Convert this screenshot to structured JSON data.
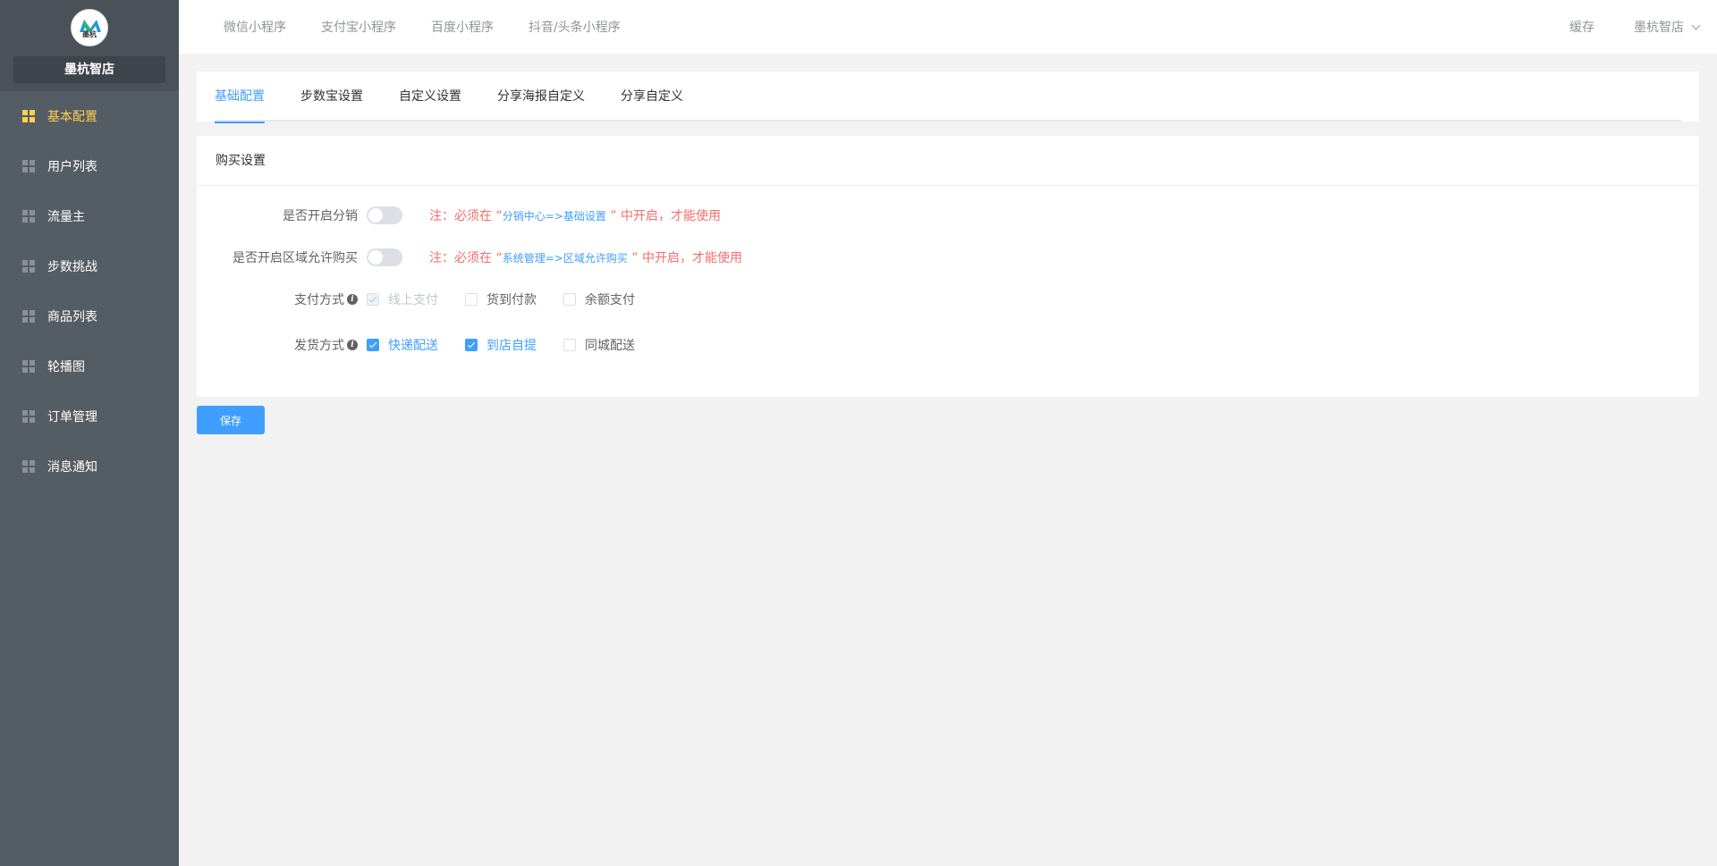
{
  "sidebar": {
    "logo_text": "墨杭",
    "shop_name": "墨杭智店",
    "items": [
      {
        "label": "基本配置",
        "active": true
      },
      {
        "label": "用户列表"
      },
      {
        "label": "流量主"
      },
      {
        "label": "步数挑战"
      },
      {
        "label": "商品列表"
      },
      {
        "label": "轮播图"
      },
      {
        "label": "订单管理"
      },
      {
        "label": "消息通知"
      }
    ]
  },
  "topbar": {
    "nav": [
      "微信小程序",
      "支付宝小程序",
      "百度小程序",
      "抖音/头条小程序"
    ],
    "cache": "缓存",
    "user": "墨杭智店"
  },
  "tabs": [
    "基础配置",
    "步数宝设置",
    "自定义设置",
    "分享海报自定义",
    "分享自定义"
  ],
  "card": {
    "title": "购买设置",
    "distribution": {
      "label": "是否开启分销",
      "enabled": false,
      "note_prefix": "注：必须在 “",
      "note_link": "分销中心=>基础设置",
      "note_suffix": " ” 中开启，才能使用"
    },
    "region": {
      "label": "是否开启区域允许购买",
      "enabled": false,
      "note_prefix": "注：必须在 “",
      "note_link": "系统管理=>区域允许购买",
      "note_suffix": " ” 中开启，才能使用"
    },
    "payment": {
      "label": "支付方式",
      "options": [
        {
          "label": "线上支付",
          "checked": true,
          "disabled": true
        },
        {
          "label": "货到付款",
          "checked": false
        },
        {
          "label": "余额支付",
          "checked": false
        }
      ]
    },
    "delivery": {
      "label": "发货方式",
      "options": [
        {
          "label": "快递配送",
          "checked": true
        },
        {
          "label": "到店自提",
          "checked": true
        },
        {
          "label": "同城配送",
          "checked": false
        }
      ]
    }
  },
  "save_label": "保存",
  "colors": {
    "primary": "#409eff",
    "sidebar_bg": "#545c64",
    "active_menu": "#ffd04b",
    "note": "#f56c6c"
  }
}
